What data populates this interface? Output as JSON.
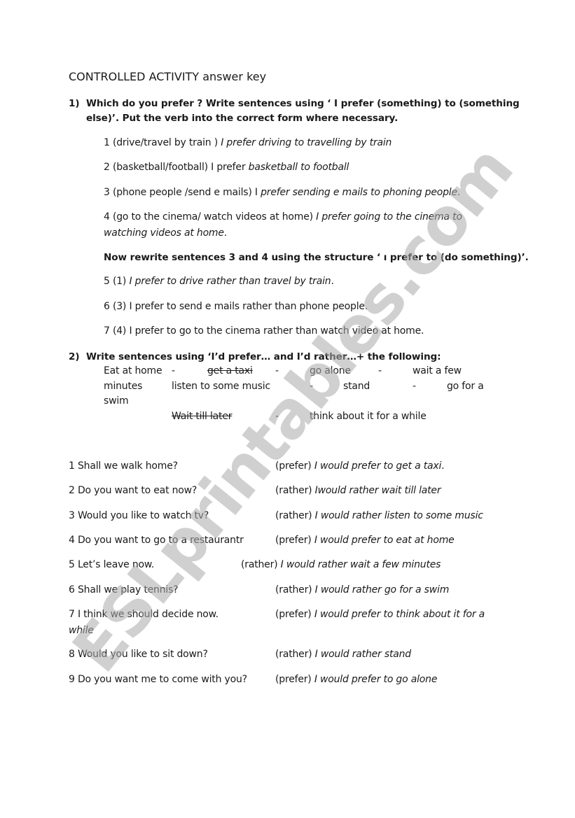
{
  "title": "CONTROLLED ACTIVITY answer key",
  "watermark": "ESLprintables.com",
  "section1": {
    "number": "1)",
    "instruction_line1": "Which do you prefer ?  Write sentences using ‘ I prefer (something) to (something",
    "instruction_line2": "else)’. Put the verb into the correct form where necessary.",
    "items": [
      {
        "prompt": "1 (drive/travel by train ) ",
        "answer": "I prefer driving to travelling by train"
      },
      {
        "prompt": "2 (basketball/football)    I prefer ",
        "answer": "basketball to football"
      },
      {
        "prompt": "3 (phone people  /send e mails) I ",
        "answer": "prefer sending e mails to phoning people",
        "tail": "."
      },
      {
        "prompt": "4 (go to the cinema/ watch videos at home) ",
        "answer": "I prefer going to the cinema to",
        "answer_line2": "watching videos at home",
        "tail": "."
      }
    ],
    "rewrite_instruction": "Now rewrite sentences 3 and 4 using the structure ‘ ı prefer to (do something)’.",
    "rewrite_items": [
      {
        "prompt": "5 (1) ",
        "answer": "I prefer to drive rather than travel by train",
        "tail": "."
      },
      {
        "prompt": "6 (3)  I prefer to send e mails rather than phone people."
      },
      {
        "prompt": "7 (4)  I prefer to go to the cinema rather than watch video at home."
      }
    ]
  },
  "section2": {
    "number": "2)",
    "instruction": "Write sentences using ‘I’d prefer… and I’d rather…+ the following:",
    "word_bank": [
      {
        "text": "Eat at home",
        "crossed": false
      },
      {
        "text": "get a taxi",
        "crossed": true
      },
      {
        "text": "go alone",
        "crossed": false
      },
      {
        "text": "wait a few minutes",
        "crossed": false
      },
      {
        "text": "listen to some  music",
        "crossed": false
      },
      {
        "text": "stand",
        "crossed": false
      },
      {
        "text": "go for a swim",
        "crossed": false
      },
      {
        "text": "Wait till later",
        "crossed": true
      },
      {
        "text": "think about it for a while",
        "crossed": false
      }
    ],
    "separator": "-",
    "items": [
      {
        "question": "1 Shall we walk home?",
        "hint": "(prefer) ",
        "answer": "I would prefer to get a taxi",
        "tail": "."
      },
      {
        "question": "2 Do you want to eat now?",
        "hint": "(rather) ",
        "answer": "Iwould rather wait till later"
      },
      {
        "question": "3 Would you like to watch tv?",
        "hint": "(rather) ",
        "answer": "I would rather listen to some music"
      },
      {
        "question": "4 Do you want to go to a restaurantr",
        "hint": "(prefer) ",
        "answer": "I would prefer to eat at home"
      },
      {
        "question": "5 Let’s leave now.",
        "hint": "(rather) ",
        "answer": "I would rather wait a few minutes"
      },
      {
        "question": "6 Shall we play tennis?",
        "hint": "(rather) ",
        "answer": "I would rather go for a swim"
      },
      {
        "question": "7 I think we should decide now.",
        "hint": "(prefer) ",
        "answer": "I would prefer to think about it for a",
        "answer_line2": "while"
      },
      {
        "question": "8 Would you like to sit down?",
        "hint": "(rather) ",
        "answer": "I would rather stand"
      },
      {
        "question": "9 Do you want me to come with you?",
        "hint": "(prefer) ",
        "answer": "I would prefer to go alone"
      }
    ]
  }
}
